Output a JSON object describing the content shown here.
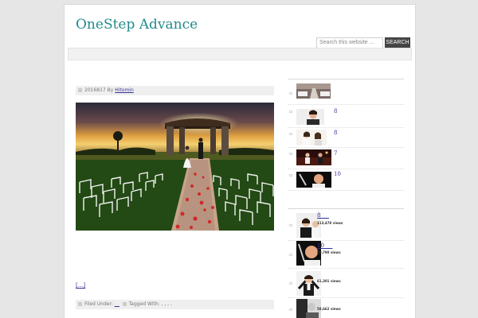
{
  "site": {
    "title": "OneStep Advance"
  },
  "search": {
    "placeholder": "Search this website ...",
    "button_label": "SEARCH"
  },
  "post": {
    "date": "2016817",
    "by": "By",
    "author": "Hitomin",
    "read_more": "[...]",
    "footer": {
      "filed_under_label": "Filed Under:",
      "filed_under_value": "__",
      "tagged_with_label": "Tagged With: , , , ,"
    }
  },
  "sidebar": {
    "recent": [
      {
        "num": "",
        "image": "wedding-aisle-thumb"
      },
      {
        "num": "8",
        "image": "man-portrait-thumb"
      },
      {
        "num": "8",
        "image": "bride-thumb"
      },
      {
        "num": "7",
        "image": "stage-thumb"
      },
      {
        "num": "10",
        "image": "microphone-thumb"
      }
    ],
    "popular": [
      {
        "title": "8___",
        "views": "113,478 views"
      },
      {
        "title": "10___",
        "views": "60,790 views"
      },
      {
        "title": "",
        "views": "61,301 views"
      },
      {
        "title": "",
        "views": "58,662 views"
      }
    ]
  }
}
